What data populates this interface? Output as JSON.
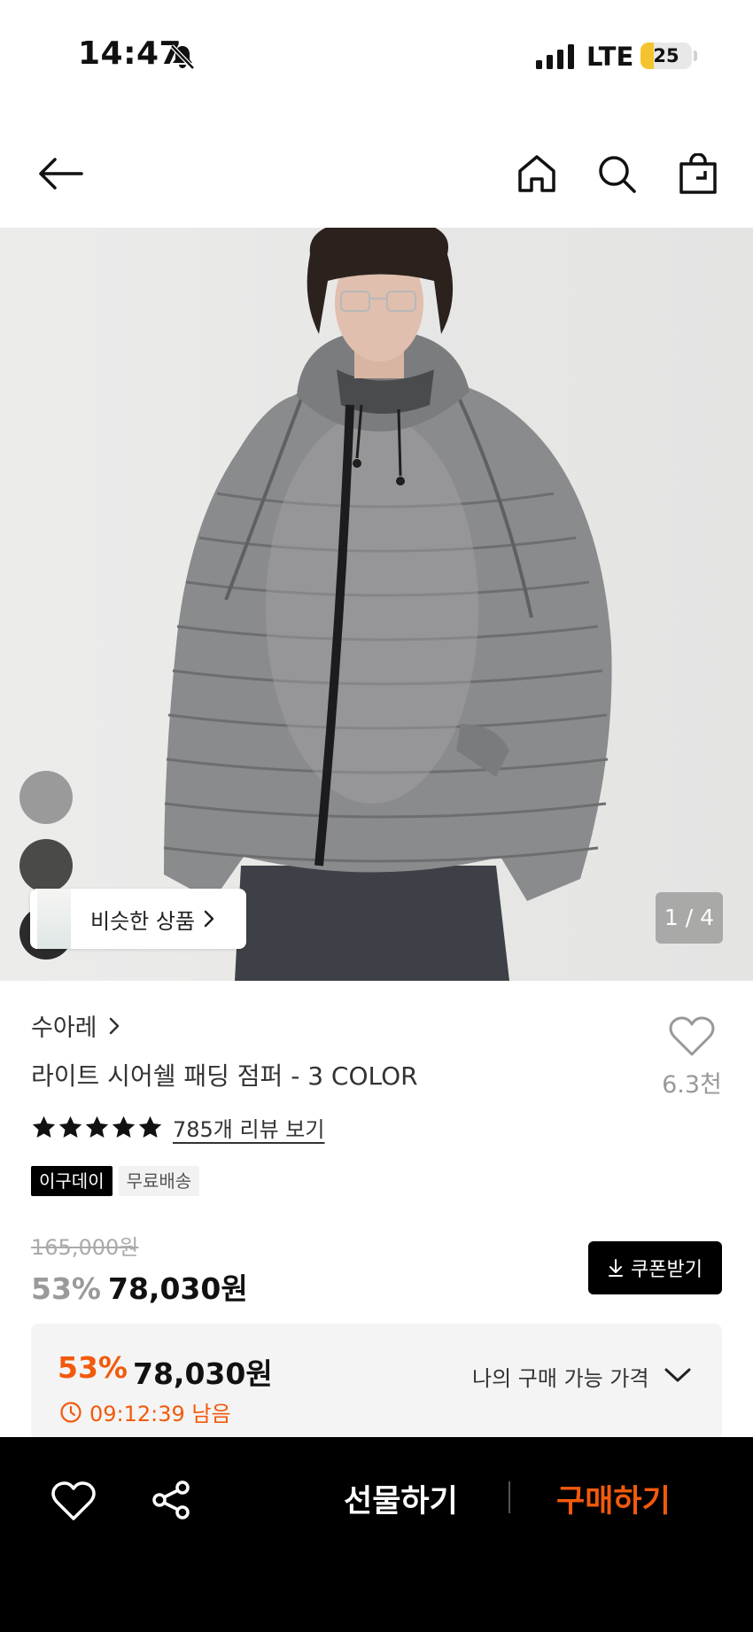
{
  "status_bar": {
    "time": "14:47",
    "network": "LTE",
    "battery_level": "25",
    "battery_fraction": 0.25,
    "icons": [
      "bell-slash-icon",
      "signal-icon",
      "battery-icon"
    ]
  },
  "nav": {
    "icons": [
      "back-arrow-icon",
      "home-icon",
      "search-icon",
      "shopping-bag-icon"
    ]
  },
  "gallery": {
    "page_indicator": "1 / 4",
    "similar_label": "비슷한 상품",
    "color_swatches": [
      "#9a9a9a",
      "#4a4a46",
      "#2b2b2b"
    ]
  },
  "product": {
    "brand": "수아레",
    "title": "라이트 시어쉘 패딩 점퍼 - 3 COLOR",
    "likes": "6.3천",
    "rating_stars": 5,
    "review_link": "785개 리뷰 보기",
    "badges": [
      "이구데이",
      "무료배송"
    ],
    "original_price": "165,000원",
    "discount_rate": "53%",
    "price": "78,030원",
    "coupon_label": "쿠폰받기"
  },
  "my_price": {
    "discount_rate": "53%",
    "price": "78,030원",
    "timer": "09:12:39 남음",
    "label": "나의 구매 가능 가격"
  },
  "bottom_bar": {
    "gift_label": "선물하기",
    "buy_label": "구매하기"
  },
  "colors": {
    "accent": "#f25a0c",
    "text_primary": "#111111",
    "text_muted": "#999999",
    "bottom_bar_bg": "#000000"
  }
}
